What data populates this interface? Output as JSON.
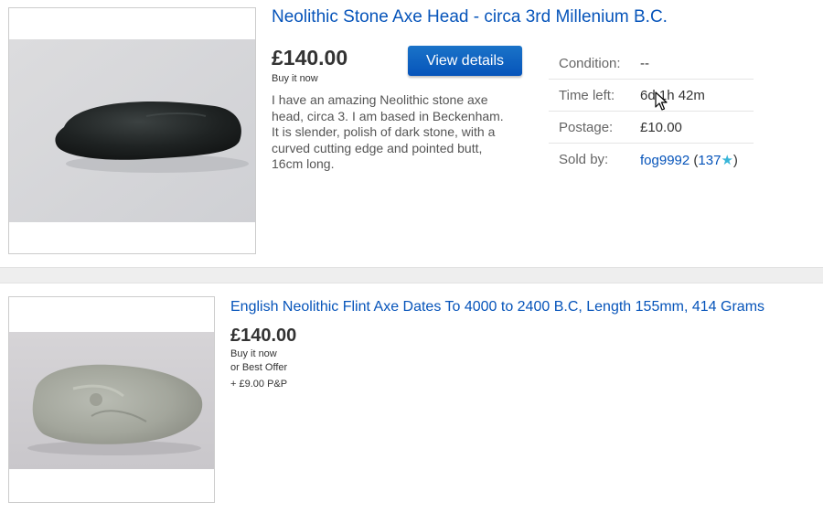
{
  "listing_1": {
    "title": "Neolithic Stone Axe Head - circa 3rd Millenium B.C.",
    "price": "£140.00",
    "format": "Buy it now",
    "view_details_label": "View details",
    "description": "I have an amazing Neolithic stone axe head, circa 3. I am based in Beckenham. It is slender, polish of dark stone, with a curved cutting edge and pointed butt, 16cm long.",
    "specs": {
      "condition_label": "Condition:",
      "condition_value": "--",
      "time_left_label": "Time left:",
      "time_left_value": "6d 1h 42m",
      "postage_label": "Postage:",
      "postage_value": "£10.00",
      "sold_by_label": "Sold by:",
      "seller_name": "fog9992",
      "seller_open": " (",
      "feedback_score": "137",
      "star_glyph": "★",
      "seller_close": ")"
    },
    "image_icon": "dark-stone-axe-photo"
  },
  "listing_2": {
    "title": "English Neolithic Flint Axe Dates To 4000 to 2400 B.C, Length 155mm, 414 Grams",
    "price": "£140.00",
    "format": "Buy it now",
    "best_offer": "or Best Offer",
    "postage": "+ £9.00 P&P",
    "image_icon": "flint-axe-photo"
  },
  "colors": {
    "link": "#0654ba",
    "button": "#0654ba",
    "star": "#38b5d8",
    "divider": "#eeeeee"
  }
}
